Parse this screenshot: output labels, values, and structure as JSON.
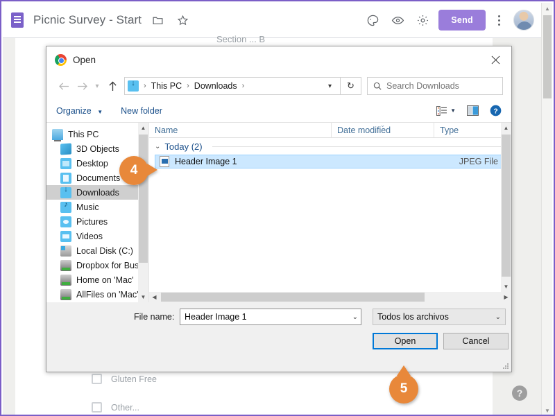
{
  "app_header": {
    "logo_icon": "forms-document-icon",
    "doc_title": "Picnic Survey - Start",
    "folder_icon": "folder-icon",
    "star_icon": "star-icon",
    "palette_icon": "palette-icon",
    "preview_icon": "eye-preview-icon",
    "settings_icon": "gear-icon",
    "send_label": "Send",
    "more_icon": "kebab-more-icon",
    "avatar_icon": "user-avatar"
  },
  "background_form": {
    "section_label": "Section ... B",
    "checkboxes": [
      {
        "label": "Gluten Free"
      },
      {
        "label": "Other..."
      }
    ],
    "help_icon": "question-mark-help-icon"
  },
  "dialog": {
    "app_icon": "chrome-icon",
    "title": "Open",
    "close_icon": "close-x-icon",
    "nav": {
      "back_icon": "arrow-left-icon",
      "forward_icon": "arrow-right-icon",
      "recent_icon": "chevron-down-icon",
      "up_icon": "arrow-up-icon",
      "address_icon": "downloads-folder-icon",
      "breadcrumbs": [
        "This PC",
        "Downloads"
      ],
      "address_caret_icon": "chevron-down-icon",
      "refresh_icon": "refresh-icon",
      "search_icon": "search-icon",
      "search_placeholder": "Search Downloads"
    },
    "commandbar": {
      "organize_label": "Organize",
      "organize_caret_icon": "caret-down-icon",
      "new_folder_label": "New folder",
      "view_icon": "list-view-icon",
      "view_caret_icon": "caret-down-icon",
      "preview_pane_icon": "preview-pane-icon",
      "help_icon": "help-question-icon"
    },
    "tree": {
      "scroll_up_icon": "chevron-up-icon",
      "scroll_down_icon": "chevron-down-icon",
      "items": [
        {
          "label": "This PC",
          "icon": "this-pc-icon",
          "selected": false,
          "root": true
        },
        {
          "label": "3D Objects",
          "icon": "3d-objects-icon",
          "selected": false
        },
        {
          "label": "Desktop",
          "icon": "desktop-folder-icon",
          "selected": false
        },
        {
          "label": "Documents",
          "icon": "documents-icon",
          "selected": false
        },
        {
          "label": "Downloads",
          "icon": "downloads-icon",
          "selected": true
        },
        {
          "label": "Music",
          "icon": "music-icon",
          "selected": false
        },
        {
          "label": "Pictures",
          "icon": "pictures-icon",
          "selected": false
        },
        {
          "label": "Videos",
          "icon": "videos-icon",
          "selected": false
        },
        {
          "label": "Local Disk (C:)",
          "icon": "local-disk-icon",
          "selected": false
        },
        {
          "label": "Dropbox for Bus",
          "icon": "network-drive-icon",
          "selected": false
        },
        {
          "label": "Home on 'Mac'",
          "icon": "network-drive-icon",
          "selected": false
        },
        {
          "label": "AllFiles on 'Mac'",
          "icon": "network-drive-icon",
          "selected": false
        }
      ]
    },
    "filelist": {
      "columns": [
        {
          "label": "Name",
          "sorted": false
        },
        {
          "label": "Date modified",
          "sorted": true,
          "sort_icon": "sort-descending-caret"
        },
        {
          "label": "Type",
          "sorted": false
        }
      ],
      "group": {
        "caret_icon": "chevron-down-icon",
        "label": "Today (2)"
      },
      "rows": [
        {
          "icon": "jpeg-file-icon",
          "name": "Header Image 1",
          "type": "JPEG File",
          "selected": true
        }
      ],
      "vscroll_up_icon": "chevron-up-icon",
      "vscroll_down_icon": "chevron-down-icon",
      "hscroll_left_icon": "chevron-left-icon",
      "hscroll_right_icon": "chevron-right-icon"
    },
    "footer": {
      "filename_label": "File name:",
      "filename_value": "Header Image 1",
      "filename_caret_icon": "chevron-down-icon",
      "filter_value": "Todos los archivos",
      "filter_caret_icon": "chevron-down-icon",
      "open_label": "Open",
      "cancel_label": "Cancel",
      "resize_grip_icon": "resize-grip-icon"
    }
  },
  "callouts": [
    {
      "number": "4"
    },
    {
      "number": "5"
    }
  ],
  "colors": {
    "accent_purple": "#9a7ddb",
    "callout_orange": "#e8883a",
    "selection_blue": "#cce8ff",
    "focus_blue": "#0078d7",
    "link_blue": "#1a4f8a"
  }
}
